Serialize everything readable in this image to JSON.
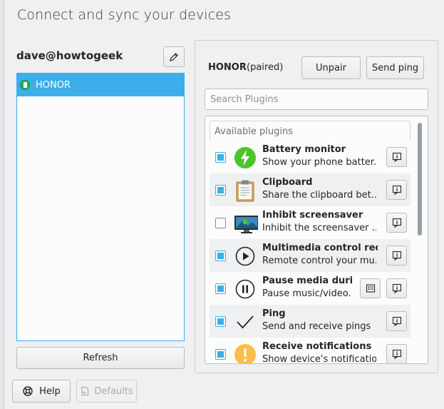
{
  "header": {
    "title": "Connect and sync your devices"
  },
  "account": {
    "name": "dave@howtogeek"
  },
  "devices": [
    {
      "name": "HONOR"
    }
  ],
  "actions": {
    "refresh": "Refresh",
    "help": "Help",
    "defaults": "Defaults"
  },
  "device": {
    "name": "HONOR",
    "status": "(paired)",
    "unpair": "Unpair",
    "send_ping": "Send ping"
  },
  "search": {
    "placeholder": "Search Plugins"
  },
  "plugins": {
    "header": "Available plugins",
    "items": [
      {
        "name": "Battery monitor",
        "desc": "Show your phone batter...",
        "enabled": true,
        "icon": "battery-icon"
      },
      {
        "name": "Clipboard",
        "desc": "Share the clipboard bet...",
        "enabled": true,
        "icon": "clipboard-icon"
      },
      {
        "name": "Inhibit screensaver",
        "desc": "Inhibit the screensaver ...",
        "enabled": false,
        "icon": "screensaver-icon"
      },
      {
        "name": "Multimedia control recei...",
        "desc": "Remote control your mu...",
        "enabled": true,
        "icon": "play-icon"
      },
      {
        "name": "Pause media durin...",
        "desc": "Pause music/video...",
        "enabled": true,
        "icon": "pause-icon"
      },
      {
        "name": "Ping",
        "desc": "Send and receive pings",
        "enabled": true,
        "icon": "checkmark-icon"
      },
      {
        "name": "Receive notifications",
        "desc": "Show device's notificatio...",
        "enabled": true,
        "icon": "notification-icon"
      }
    ]
  },
  "colors": {
    "accent": "#3daee9",
    "background": "#eff0f1",
    "device_online": "#27ae60"
  }
}
